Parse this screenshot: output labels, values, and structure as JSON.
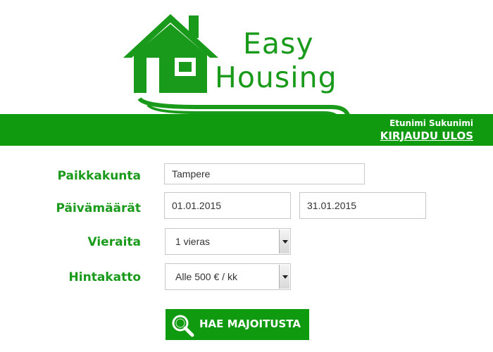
{
  "brand": {
    "line1": "Easy",
    "line2": "Housing",
    "color": "#1a9a1a",
    "bar_color": "#0f9a0f"
  },
  "header": {
    "user_name": "Etunimi Sukunimi",
    "logout_label": "KIRJAUDU ULOS"
  },
  "form": {
    "location": {
      "label": "Paikkakunta",
      "value": "Tampere"
    },
    "dates": {
      "label": "Päivämäärät",
      "start": "01.01.2015",
      "end": "31.01.2015"
    },
    "guests": {
      "label": "Vieraita",
      "selected": "1 vieras"
    },
    "price_cap": {
      "label": "Hintakatto",
      "selected": "Alle 500 € / kk"
    }
  },
  "search_button": {
    "label": "HAE MAJOITUSTA",
    "icon": "search-icon"
  }
}
